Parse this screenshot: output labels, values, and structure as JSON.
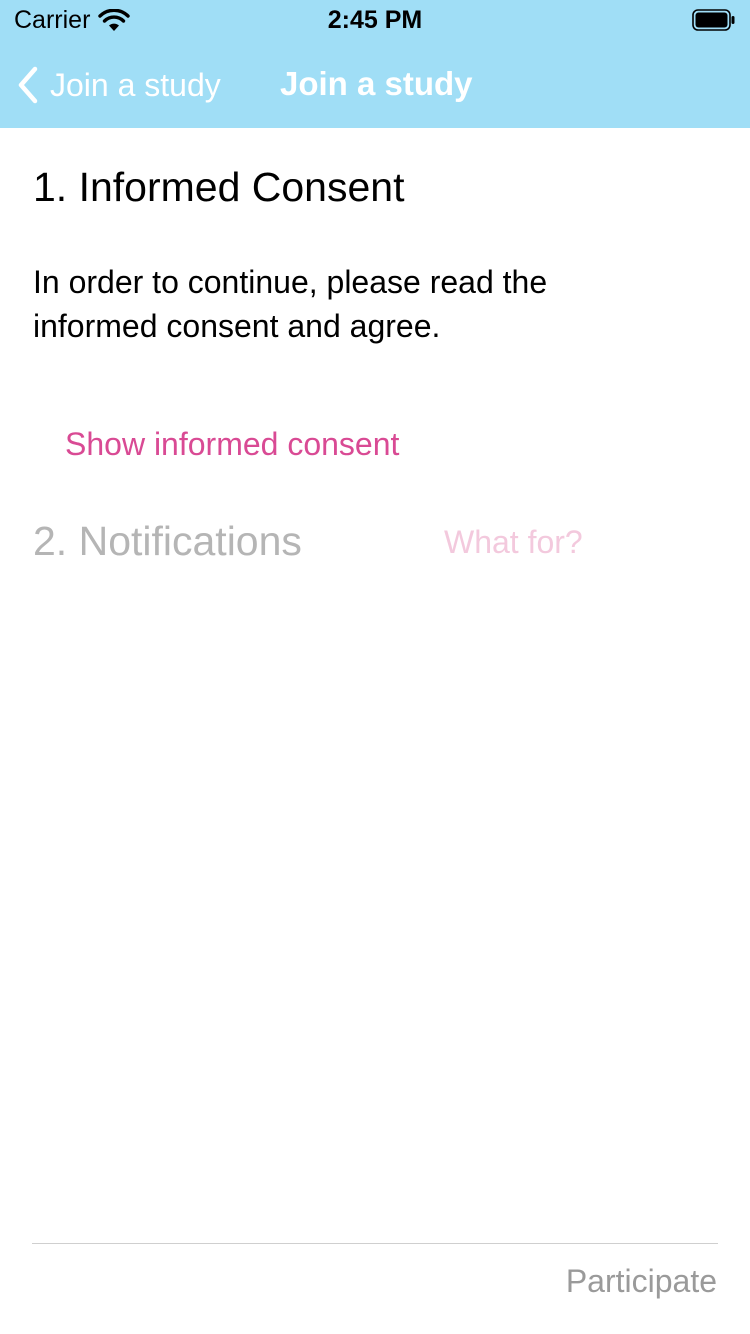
{
  "status_bar": {
    "carrier": "Carrier",
    "time": "2:45 PM",
    "icons": [
      "wifi-icon",
      "battery-icon"
    ]
  },
  "nav": {
    "back_label": "Join a study",
    "title": "Join a study",
    "back_icon": "chevron-left-icon"
  },
  "consent": {
    "title": "1. Informed Consent",
    "text": "In order to continue, please read the informed consent and agree.",
    "show_link": "Show informed consent"
  },
  "notifications": {
    "title": "2. Notifications",
    "what_for": "What for?"
  },
  "footer": {
    "participate_label": "Participate"
  },
  "colors": {
    "navbar": "#a0def6",
    "accent": "#d94a94",
    "accent_disabled": "#f3c9dd",
    "disabled_text": "#b5b5b5"
  }
}
